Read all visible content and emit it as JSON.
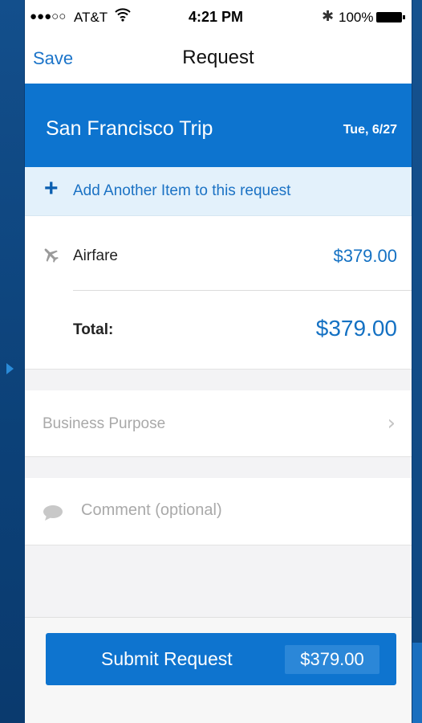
{
  "status_bar": {
    "signal": "●●●○○",
    "carrier": "AT&T",
    "time": "4:21 PM",
    "battery": "100%"
  },
  "nav": {
    "save_label": "Save",
    "title": "Request"
  },
  "trip": {
    "name": "San Francisco Trip",
    "date": "Tue, 6/27"
  },
  "add_item": {
    "icon": "plus-icon",
    "label": "Add Another Item to this request"
  },
  "items": [
    {
      "icon": "airplane-icon",
      "label": "Airfare",
      "amount": "$379.00"
    }
  ],
  "total": {
    "label": "Total:",
    "amount": "$379.00"
  },
  "business_purpose": {
    "label": "Business Purpose",
    "icon": "chevron-right-icon"
  },
  "comment": {
    "icon": "comment-bubble-icon",
    "placeholder": "Comment (optional)"
  },
  "submit": {
    "label": "Submit Request",
    "amount": "$379.00"
  },
  "colors": {
    "accent": "#0d74cf",
    "link": "#1b74c9",
    "add_row_bg": "#e3f1fb",
    "background": "#0d4a86"
  }
}
